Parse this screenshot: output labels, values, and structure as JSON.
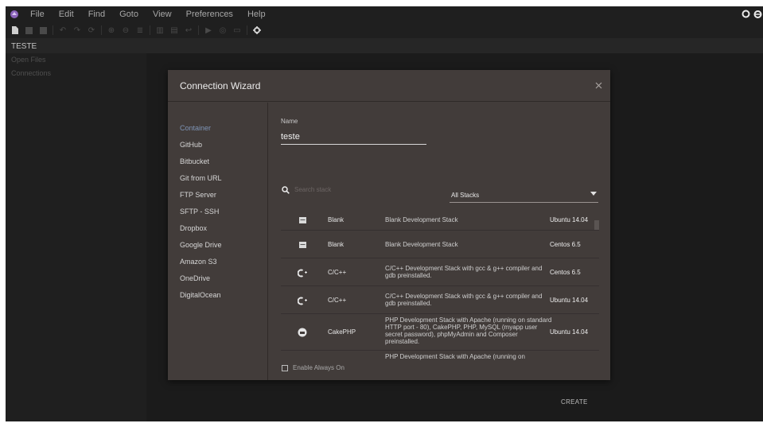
{
  "menu": [
    "File",
    "Edit",
    "Find",
    "Goto",
    "View",
    "Preferences",
    "Help"
  ],
  "project": {
    "title": "TESTE"
  },
  "left_panel": {
    "links": [
      "Open Files",
      "Connections"
    ]
  },
  "dialog": {
    "title": "Connection Wizard",
    "nav": [
      {
        "label": "Container",
        "active": true
      },
      {
        "label": "GitHub"
      },
      {
        "label": "Bitbucket"
      },
      {
        "label": "Git from URL"
      },
      {
        "label": "FTP Server"
      },
      {
        "label": "SFTP - SSH"
      },
      {
        "label": "Dropbox"
      },
      {
        "label": "Google Drive"
      },
      {
        "label": "Amazon S3"
      },
      {
        "label": "OneDrive"
      },
      {
        "label": "DigitalOcean"
      }
    ],
    "name_label": "Name",
    "name_value": "teste",
    "search_placeholder": "Search stack",
    "stack_filter": "All Stacks",
    "stacks": [
      {
        "icon": "blank-stack-icon",
        "name": "Blank",
        "description": "Blank Development Stack",
        "os": "Ubuntu 14.04"
      },
      {
        "icon": "blank-stack-icon",
        "name": "Blank",
        "description": "Blank Development Stack",
        "os": "Centos 6.5"
      },
      {
        "icon": "cpp-stack-icon",
        "name": "C/C++",
        "description": "C/C++ Development Stack with gcc & g++ compiler and gdb preinstalled.",
        "os": "Centos 6.5"
      },
      {
        "icon": "cpp-stack-icon",
        "name": "C/C++",
        "description": "C/C++ Development Stack with gcc & g++ compiler and gdb preinstalled.",
        "os": "Ubuntu 14.04"
      },
      {
        "icon": "cakephp-stack-icon",
        "name": "CakePHP",
        "description": "PHP Development Stack with Apache (running on standard HTTP port - 80), CakePHP, PHP, MySQL (myapp user secret password), phpMyAdmin and Composer preinstalled.",
        "os": "Ubuntu 14.04"
      },
      {
        "icon": "php-stack-icon",
        "name": "",
        "description": "PHP Development Stack with Apache (running on",
        "os": ""
      }
    ],
    "always_on_label": "Enable Always On",
    "create_label": "CREATE"
  }
}
